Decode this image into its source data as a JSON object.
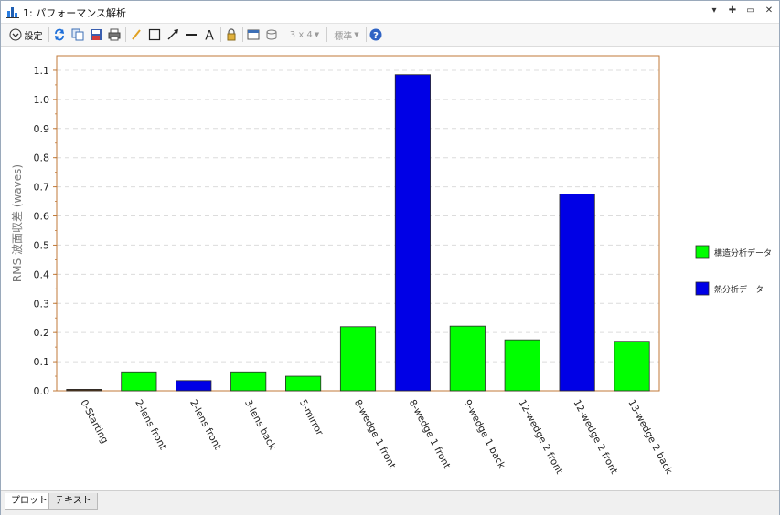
{
  "window": {
    "title": "1: パフォーマンス解析",
    "controls": [
      "▾",
      "✚",
      "▭",
      "✕"
    ]
  },
  "toolbar": {
    "settings_label": "設定",
    "layout_label": "3 x 4",
    "standard_label": "標準"
  },
  "tabs": [
    {
      "label": "プロット",
      "active": true
    },
    {
      "label": "テキスト",
      "active": false
    }
  ],
  "chart_data": {
    "type": "bar",
    "ylabel": "RMS 波面収差 (waves)",
    "ylim": [
      0,
      1.1
    ],
    "yticks": [
      "0.0",
      "0.1",
      "0.2",
      "0.3",
      "0.4",
      "0.5",
      "0.6",
      "0.7",
      "0.8",
      "0.9",
      "1.0",
      "1.1"
    ],
    "grid": true,
    "legend_position": "right",
    "categories": [
      "0-Starting",
      "2-lens front",
      "2-lens front",
      "3-lens back",
      "5-mirror",
      "8-wedge 1 front",
      "8-wedge 1 front",
      "9-wedge 1 back",
      "12-wedge 2 front",
      "12-wedge 2 front",
      "13-wedge 2 back"
    ],
    "values": [
      0.005,
      0.065,
      0.035,
      0.065,
      0.05,
      0.22,
      1.085,
      0.222,
      0.175,
      0.675,
      0.17
    ],
    "bar_series": [
      null,
      0,
      1,
      0,
      0,
      0,
      1,
      0,
      0,
      1,
      0
    ],
    "starting_bar_color": "#5a3a1a",
    "series": [
      {
        "name": "構造分析データ",
        "color": "#00ff00"
      },
      {
        "name": "熱分析データ",
        "color": "#0000e6"
      }
    ],
    "axis_color": "#c07a3a"
  }
}
